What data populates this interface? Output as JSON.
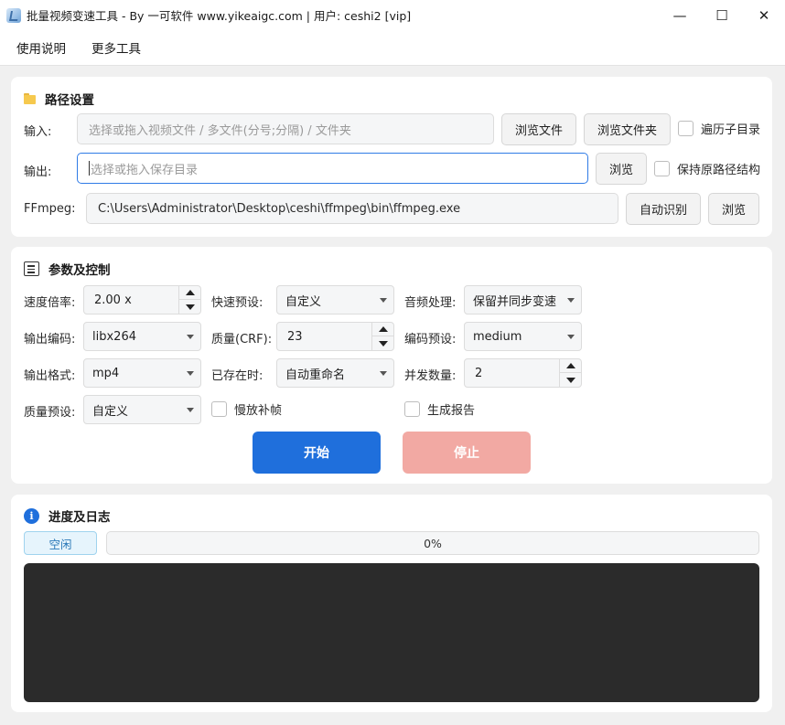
{
  "window": {
    "title": "批量视频变速工具 - By 一可软件 www.yikeaigc.com  |  用户: ceshi2 [vip]",
    "minimize_glyph": "—",
    "maximize_glyph": "☐",
    "close_glyph": "✕"
  },
  "menu": {
    "items": [
      "使用说明",
      "更多工具"
    ]
  },
  "paths": {
    "title": "路径设置",
    "input_label": "输入:",
    "input_placeholder": "选择或拖入视频文件 / 多文件(分号;分隔) / 文件夹",
    "input_value": "",
    "browse_file": "浏览文件",
    "browse_folder": "浏览文件夹",
    "recurse_label": "遍历子目录",
    "recurse_checked": false,
    "output_label": "输出:",
    "output_placeholder": "选择或拖入保存目录",
    "output_value": "",
    "browse_output": "浏览",
    "keep_structure_label": "保持原路径结构",
    "keep_structure_checked": false,
    "ffmpeg_label": "FFmpeg:",
    "ffmpeg_value": "C:\\Users\\Administrator\\Desktop\\ceshi\\ffmpeg\\bin\\ffmpeg.exe",
    "auto_detect": "自动识别",
    "browse_ffmpeg": "浏览"
  },
  "params": {
    "title": "参数及控制",
    "speed_label": "速度倍率:",
    "speed_value": "2.00 x",
    "quick_preset_label": "快速预设:",
    "quick_preset_value": "自定义",
    "audio_label": "音频处理:",
    "audio_value": "保留并同步变速",
    "codec_label": "输出编码:",
    "codec_value": "libx264",
    "crf_label": "质量(CRF):",
    "crf_value": "23",
    "enc_preset_label": "编码预设:",
    "enc_preset_value": "medium",
    "format_label": "输出格式:",
    "format_value": "mp4",
    "exists_label": "已存在时:",
    "exists_value": "自动重命名",
    "concurrency_label": "并发数量:",
    "concurrency_value": "2",
    "quality_preset_label": "质量预设:",
    "quality_preset_value": "自定义",
    "slow_interp_label": "慢放补帧",
    "slow_interp_checked": false,
    "report_label": "生成报告",
    "report_checked": false,
    "start": "开始",
    "stop": "停止"
  },
  "progress": {
    "title": "进度及日志",
    "status": "空闲",
    "percent": 0,
    "percent_text": "0%",
    "log_text": ""
  },
  "colors": {
    "accent": "#1f6fdc",
    "start_bg": "#1f6fdc",
    "stop_bg": "#f2a9a3",
    "log_bg": "#2b2b2b"
  }
}
